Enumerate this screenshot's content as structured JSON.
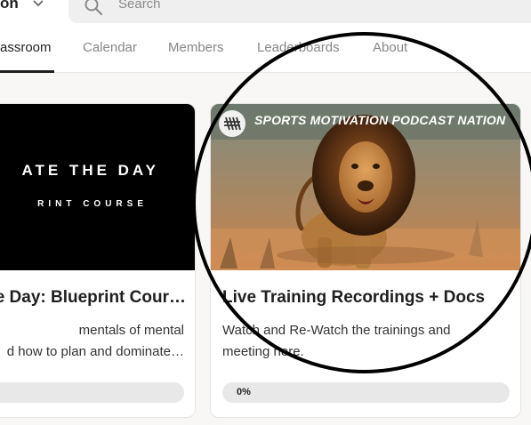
{
  "header": {
    "community_name": "on",
    "search": {
      "placeholder": "Search"
    }
  },
  "nav": {
    "tabs": [
      {
        "label": "assroom",
        "active": true
      },
      {
        "label": "Calendar",
        "active": false
      },
      {
        "label": "Members",
        "active": false
      },
      {
        "label": "Leaderboards",
        "active": false
      },
      {
        "label": "About",
        "active": false
      }
    ]
  },
  "courses": [
    {
      "thumbnail": {
        "line1": "ATE THE DAY",
        "line2": "RINT COURSE"
      },
      "title": "e Day: Blueprint Cour…",
      "description_lines": [
        "mentals of mental",
        "d how to plan and dominate…"
      ],
      "progress_percent": null
    },
    {
      "thumbnail": {
        "banner_title": "SPORTS MOTIVATION PODCAST NATION"
      },
      "title": "Live Training Recordings + Docs",
      "description": "Watch and Re-Watch the trainings and meeting here.",
      "progress_label": "0%",
      "progress_percent": 0
    }
  ],
  "colors": {
    "page_bg": "#f8f7f5",
    "active_tab": "#1f1f1f",
    "inactive_tab": "#878787",
    "progress_track": "#e8e8e8",
    "annotation": "#000000"
  },
  "icons": {
    "search": "search-icon",
    "chevron": "chevron-down-icon",
    "logo": "podcast-logo-icon"
  }
}
